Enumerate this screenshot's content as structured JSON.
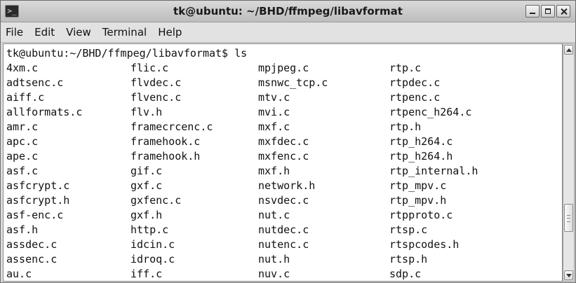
{
  "window": {
    "title": "tk@ubuntu: ~/BHD/ffmpeg/libavformat",
    "icon": "terminal-icon"
  },
  "menu": [
    "File",
    "Edit",
    "View",
    "Terminal",
    "Help"
  ],
  "prompt": "tk@ubuntu:~/BHD/ffmpeg/libavformat$ ls",
  "rows": [
    [
      "4xm.c",
      "flic.c",
      "mpjpeg.c",
      "rtp.c"
    ],
    [
      "adtsenc.c",
      "flvdec.c",
      "msnwc_tcp.c",
      "rtpdec.c"
    ],
    [
      "aiff.c",
      "flvenc.c",
      "mtv.c",
      "rtpenc.c"
    ],
    [
      "allformats.c",
      "flv.h",
      "mvi.c",
      "rtpenc_h264.c"
    ],
    [
      "amr.c",
      "framecrcenc.c",
      "mxf.c",
      "rtp.h"
    ],
    [
      "apc.c",
      "framehook.c",
      "mxfdec.c",
      "rtp_h264.c"
    ],
    [
      "ape.c",
      "framehook.h",
      "mxfenc.c",
      "rtp_h264.h"
    ],
    [
      "asf.c",
      "gif.c",
      "mxf.h",
      "rtp_internal.h"
    ],
    [
      "asfcrypt.c",
      "gxf.c",
      "network.h",
      "rtp_mpv.c"
    ],
    [
      "asfcrypt.h",
      "gxfenc.c",
      "nsvdec.c",
      "rtp_mpv.h"
    ],
    [
      "asf-enc.c",
      "gxf.h",
      "nut.c",
      "rtpproto.c"
    ],
    [
      "asf.h",
      "http.c",
      "nutdec.c",
      "rtsp.c"
    ],
    [
      "assdec.c",
      "idcin.c",
      "nutenc.c",
      "rtspcodes.h"
    ],
    [
      "assenc.c",
      "idroq.c",
      "nut.h",
      "rtsp.h"
    ],
    [
      "au.c",
      "iff.c",
      "nuv.c",
      "sdp.c"
    ]
  ]
}
